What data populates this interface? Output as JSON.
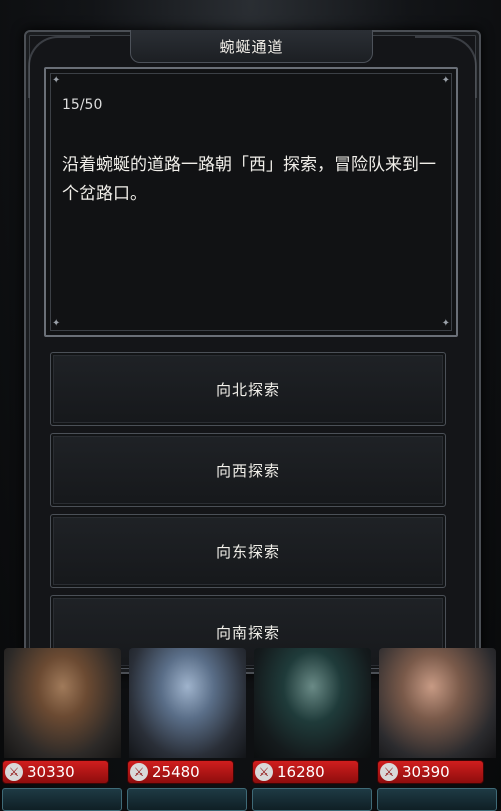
{
  "dialog": {
    "title": "蜿蜒通道",
    "progress": "15/50",
    "story": "沿着蜿蜒的道路一路朝「西」探索，冒险队来到一个岔路口。"
  },
  "options": [
    {
      "label": "向北探索"
    },
    {
      "label": "向西探索"
    },
    {
      "label": "向东探索"
    },
    {
      "label": "向南探索"
    }
  ],
  "heroes": [
    {
      "hp": "30330",
      "stat": "",
      "colors": [
        "#6b4a32",
        "#2d2a28"
      ]
    },
    {
      "hp": "25480",
      "stat": "",
      "colors": [
        "#5a6e88",
        "#2a2f38"
      ]
    },
    {
      "hp": "16280",
      "stat": "",
      "colors": [
        "#1f3b3a",
        "#141a1c"
      ]
    },
    {
      "hp": "30390",
      "stat": "",
      "colors": [
        "#7a5a4a",
        "#2b2b2e"
      ]
    }
  ],
  "colors": {
    "hp_bar": "#c41a1a",
    "panel_border": "#6a6f77",
    "stat_strip": "#1e3a44"
  },
  "icons": {
    "hp": "sword-shield-icon",
    "star": "sparkle-icon"
  }
}
